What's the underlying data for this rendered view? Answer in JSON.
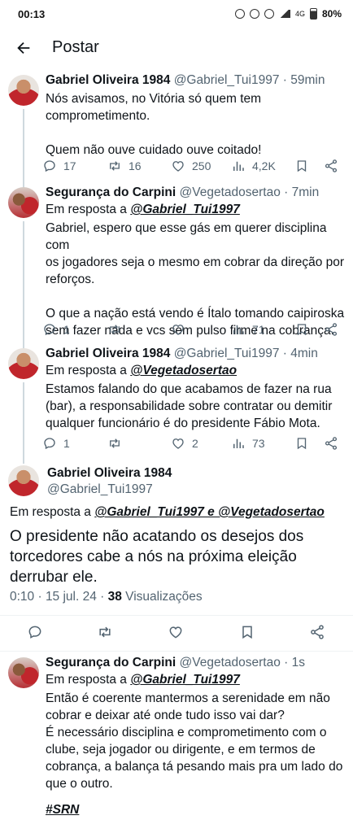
{
  "status_bar": {
    "time": "00:13",
    "network": "4G",
    "battery": "80%"
  },
  "header": {
    "title": "Postar"
  },
  "tweets": [
    {
      "name": "Gabriel Oliveira 1984",
      "meta": "@Gabriel_Tui1997 · 59min",
      "reply_prefix": "",
      "reply_to": "",
      "text": "Nós avisamos, no Vitória só quem tem\ncomprometimento.\n\nQuem não ouve cuidado ouve coitado!",
      "replies": "17",
      "retweets": "16",
      "likes": "250",
      "views": "4,2K"
    },
    {
      "name": "Segurança do Carpini",
      "meta": "@Vegetadosertao · 7min",
      "reply_prefix": "Em resposta a ",
      "reply_to": "@Gabriel_Tui1997",
      "text": "Gabriel, espero que esse gás em querer disciplina com\nos jogadores seja o mesmo em cobrar da direção por\nreforços.\n\nO que a nação está vendo é Ítalo tomando caipiroska\nsem fazer nada e vcs sem pulso firme na cobrança.",
      "replies": "1",
      "retweets": "",
      "likes": "",
      "views": "71"
    },
    {
      "name": "Gabriel Oliveira 1984",
      "meta": "@Gabriel_Tui1997 · 4min",
      "reply_prefix": "Em resposta a ",
      "reply_to": "@Vegetadosertao",
      "text": "Estamos falando do que acabamos de fazer na rua\n(bar), a responsabilidade sobre contratar ou demitir\nqualquer funcionário é do presidente Fábio Mota.",
      "replies": "1",
      "retweets": "",
      "likes": "2",
      "views": "73"
    }
  ],
  "main_tweet": {
    "name": "Gabriel Oliveira 1984",
    "handle": "@Gabriel_Tui1997",
    "reply_prefix": "Em resposta a ",
    "reply_to": "@Gabriel_Tui1997 e @Vegetadosertao",
    "text": "O presidente não acatando os desejos dos torcedores cabe a nós na próxima eleição derrubar ele.",
    "time": "0:10 · 15 jul. 24 · ",
    "views_count": "38",
    "views_label": " Visualizações"
  },
  "last_tweet": {
    "name": "Segurança do Carpini",
    "meta": "@Vegetadosertao · 1s",
    "reply_prefix": "Em resposta a ",
    "reply_to": "@Gabriel_Tui1997",
    "text": "Então é coerente mantermos a serenidade em não\ncobrar e deixar até onde tudo isso vai dar?\nÉ necessário disciplina e comprometimento com o\nclube, seja jogador ou dirigente, e em termos de\ncobrança, a balança tá pesando mais pra um lado do\nque o outro.",
    "hashtag": "#SRN"
  }
}
